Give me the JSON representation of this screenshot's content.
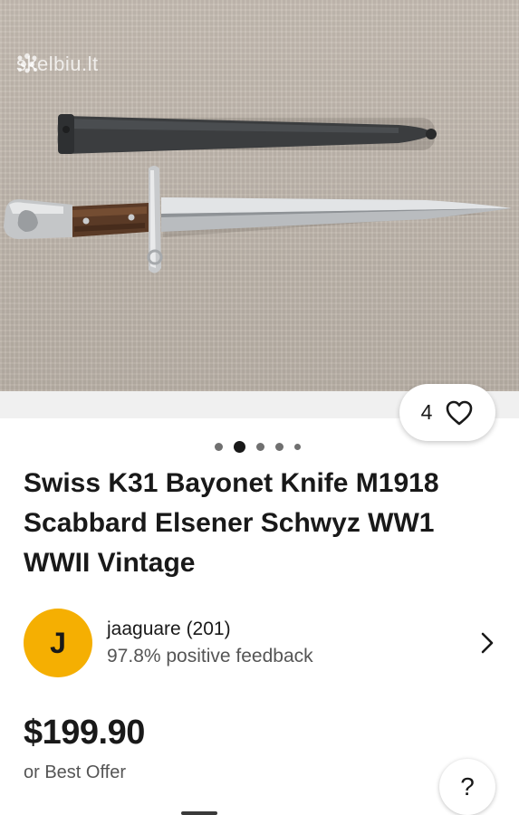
{
  "photo": {
    "watermark_text": "skelbiu.lt",
    "subject": "bayonet knife with scabbard on fabric"
  },
  "likes": {
    "count": "4",
    "icon": "heart-icon"
  },
  "carousel": {
    "total_dots": 5,
    "active_index": 1
  },
  "listing": {
    "title": "Swiss K31 Bayonet Knife M1918 Scabbard Elsener Schwyz WW1 WWII Vintage"
  },
  "seller": {
    "avatar_letter": "J",
    "avatar_color": "#f5af02",
    "name": "jaaguare (201)",
    "feedback": "97.8% positive feedback"
  },
  "pricing": {
    "price": "$199.90",
    "offer_text": "or Best Offer"
  },
  "help": {
    "label": "?"
  }
}
